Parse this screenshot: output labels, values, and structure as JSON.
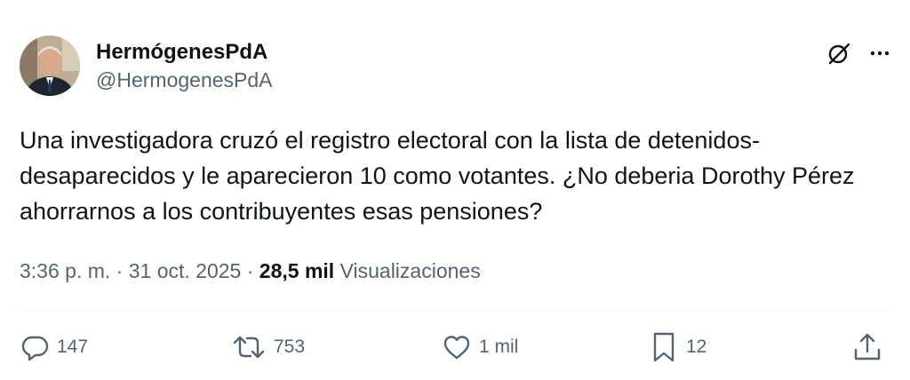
{
  "author": {
    "display_name": "HermógenesPdA",
    "handle": "@HermogenesPdA"
  },
  "tweet": {
    "text": "Una investigadora cruzó el registro electoral con la lista de detenidos-desaparecidos  y le aparecieron 10 como votantes. ¿No deberia Dorothy Pérez ahorrarnos a los contribuyentes esas pensiones?"
  },
  "meta": {
    "time": "3:36 p. m.",
    "separator": "·",
    "date": "31 oct. 2025",
    "views_count": "28,5 mil",
    "views_label": "Visualizaciones"
  },
  "actions": {
    "replies": "147",
    "reposts": "753",
    "likes": "1 mil",
    "bookmarks": "12"
  },
  "colors": {
    "text_primary": "#0f1419",
    "text_secondary": "#536471",
    "divider": "#eff3f4"
  },
  "icons": [
    "grok-icon",
    "more-icon",
    "reply-icon",
    "repost-icon",
    "like-icon",
    "bookmark-icon",
    "share-icon"
  ]
}
